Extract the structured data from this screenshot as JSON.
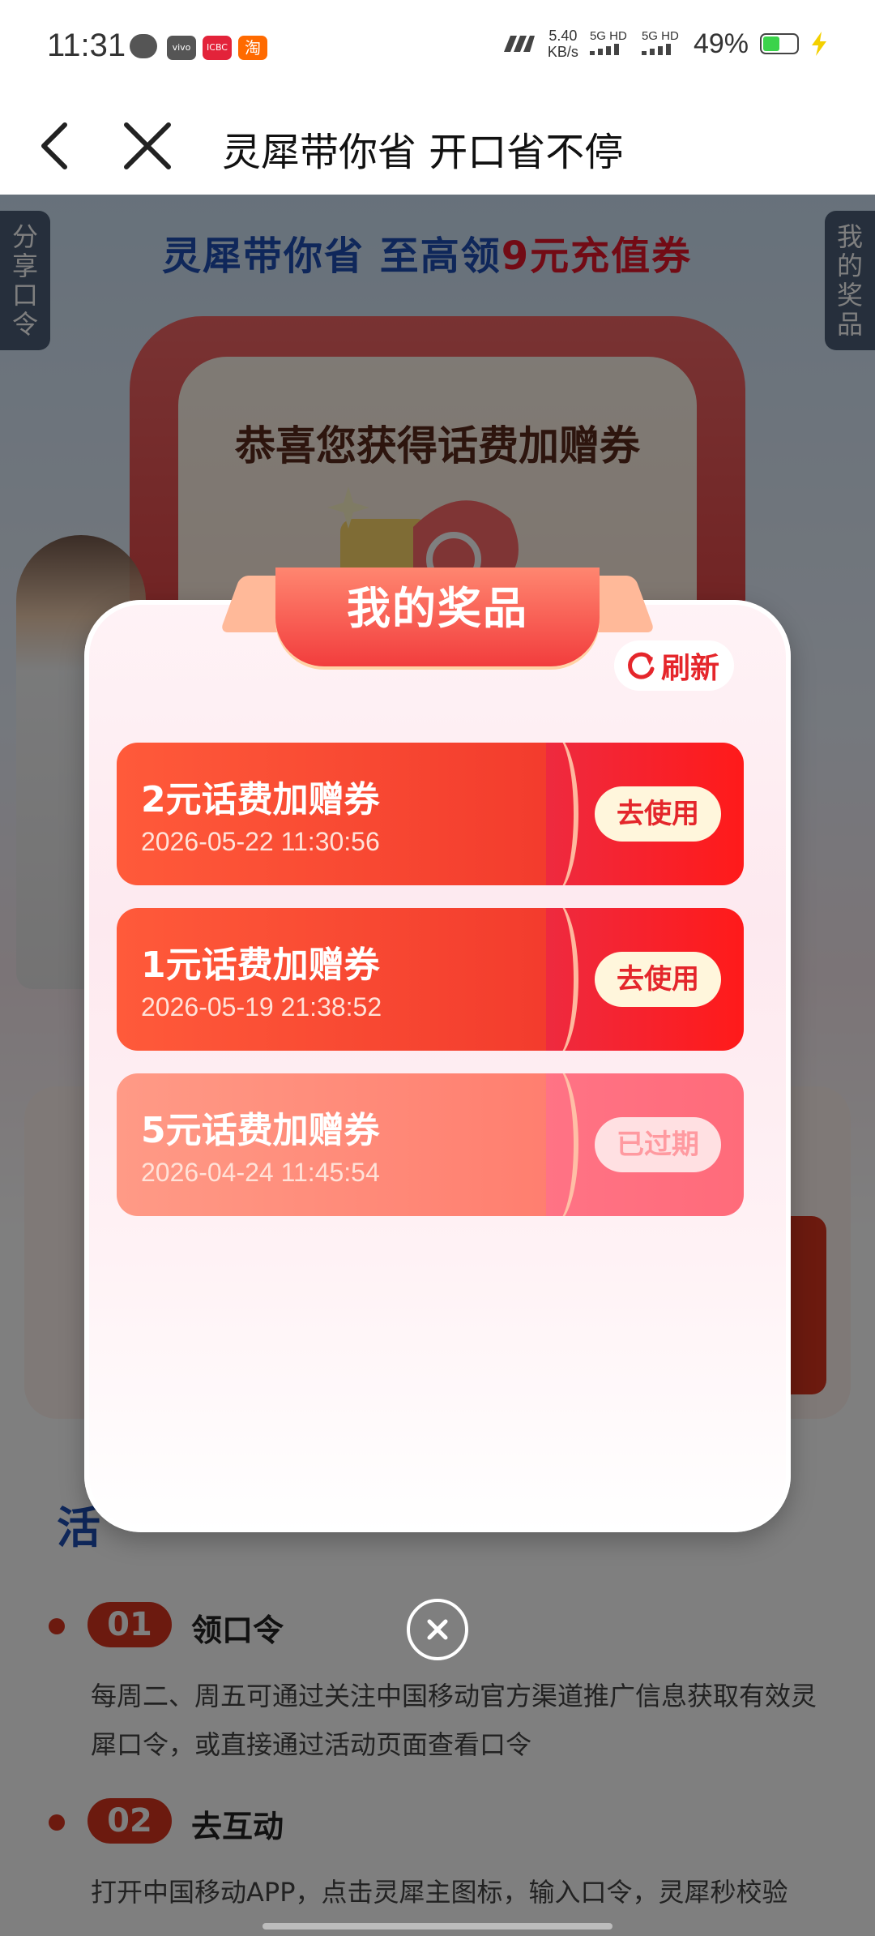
{
  "status_bar": {
    "time": "11:31",
    "net_speed_value": "5.40",
    "net_speed_unit": "KB/s",
    "sim1": "5G HD",
    "sim2": "5G HD",
    "battery_percent": "49%",
    "notification_badges": [
      "vivo",
      "ICBC",
      "淘"
    ],
    "colors": {
      "battery_fill": "#3bd34b",
      "charging": "#f4d000"
    }
  },
  "title_bar": {
    "title": "灵犀带你省 开口省不停",
    "back_icon": "chevron-left-icon",
    "close_icon": "close-icon"
  },
  "page": {
    "banner_prefix": "灵犀带你省 至高领",
    "banner_highlight": "9元充值券",
    "left_tab": "分享口令",
    "right_tab": "我的奖品",
    "congrats_text": "恭喜您获得话费加赠券",
    "steps": [
      {
        "num": "01",
        "title": "领口令",
        "desc": "每周二、周五可通过关注中国移动官方渠道推广信息获取有效灵犀口令，或直接通过活动页面查看口令"
      },
      {
        "num": "02",
        "title": "去互动",
        "desc": "打开中国移动APP，点击灵犀主图标，输入口令，灵犀秒校验"
      }
    ]
  },
  "modal": {
    "title": "我的奖品",
    "refresh_label": "刷新",
    "coupons": [
      {
        "name": "2元话费加赠券",
        "time": "2026-05-22 11:30:56",
        "action": "去使用",
        "status": "active"
      },
      {
        "name": "1元话费加赠券",
        "time": "2026-05-19 21:38:52",
        "action": "去使用",
        "status": "active"
      },
      {
        "name": "5元话费加赠券",
        "time": "2026-04-24 11:45:54",
        "action": "已过期",
        "status": "expired"
      }
    ],
    "close_icon": "close-circle-icon",
    "colors": {
      "coupon_red": "#f23a2c",
      "expired_pink": "#ff8a7a",
      "action_text": "#e4262b"
    }
  }
}
